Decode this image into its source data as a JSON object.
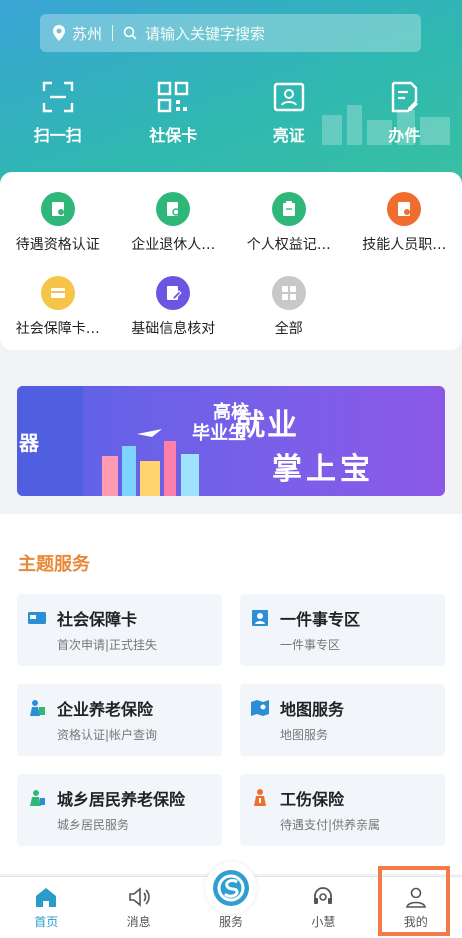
{
  "search": {
    "city": "苏州",
    "placeholder": "请输入关键字搜索"
  },
  "quick": [
    "扫一扫",
    "社保卡",
    "亮证",
    "办件"
  ],
  "services": [
    {
      "label": "待遇资格认证",
      "color": "#2fb779"
    },
    {
      "label": "企业退休人…",
      "color": "#2fb779"
    },
    {
      "label": "个人权益记…",
      "color": "#2fb779"
    },
    {
      "label": "技能人员职…",
      "color": "#ef6d2d"
    },
    {
      "label": "社会保障卡…",
      "color": "#f5c54a"
    },
    {
      "label": "基础信息核对",
      "color": "#6a56e0"
    },
    {
      "label": "全部",
      "color": "#c8c8c8"
    }
  ],
  "banner": {
    "left": "器",
    "tag": "毕业生",
    "tag2": "高校",
    "title1": "就业",
    "title2": "掌上宝"
  },
  "theme": {
    "title": "主题服务",
    "tiles": [
      {
        "title": "社会保障卡",
        "sub": "首次申请|正式挂失"
      },
      {
        "title": "一件事专区",
        "sub": "一件事专区"
      },
      {
        "title": "企业养老保险",
        "sub": "资格认证|帐户查询"
      },
      {
        "title": "地图服务",
        "sub": "地图服务"
      },
      {
        "title": "城乡居民养老保险",
        "sub": "城乡居民服务"
      },
      {
        "title": "工伤保险",
        "sub": "待遇支付|供养亲属"
      }
    ]
  },
  "tabs": [
    "首页",
    "消息",
    "服务",
    "小慧",
    "我的"
  ],
  "colors": {
    "accent": "#2a9cc9",
    "theme_title": "#e8893a",
    "highlight": "#f47a47"
  }
}
